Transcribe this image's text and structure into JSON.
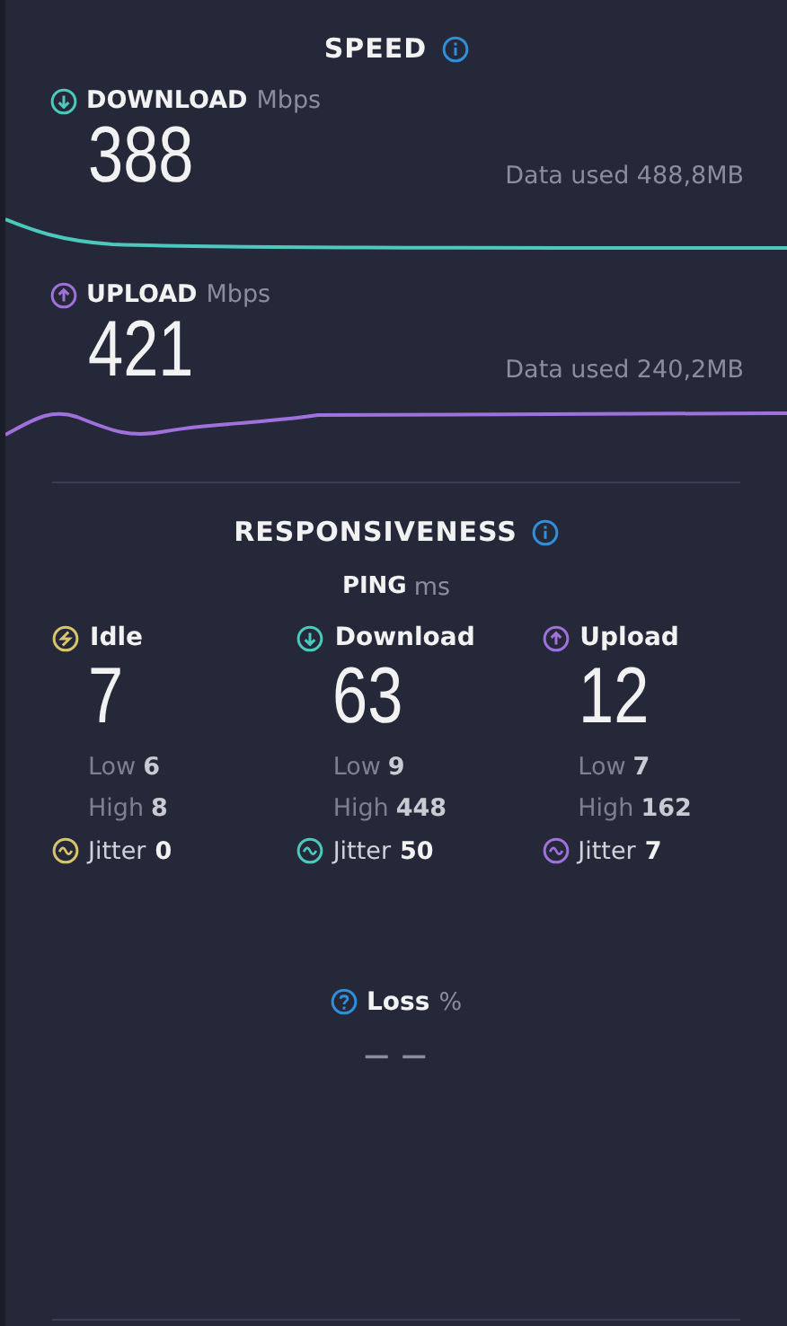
{
  "speed": {
    "title": "SPEED",
    "tests": [
      {
        "kind": "download",
        "label": "DOWNLOAD",
        "unit": "Mbps",
        "value": "388",
        "data_used": "Data used 488,8MB"
      },
      {
        "kind": "upload",
        "label": "UPLOAD",
        "unit": "Mbps",
        "value": "421",
        "data_used": "Data used 240,2MB"
      }
    ]
  },
  "responsiveness": {
    "title": "RESPONSIVENESS",
    "ping_label": "PING",
    "ping_unit": "ms",
    "metrics": [
      {
        "kind": "idle",
        "label": "Idle",
        "value": "7",
        "low_label": "Low",
        "low": "6",
        "high_label": "High",
        "high": "8",
        "jitter_label": "Jitter",
        "jitter": "0"
      },
      {
        "kind": "download",
        "label": "Download",
        "value": "63",
        "low_label": "Low",
        "low": "9",
        "high_label": "High",
        "high": "448",
        "jitter_label": "Jitter",
        "jitter": "50"
      },
      {
        "kind": "upload",
        "label": "Upload",
        "value": "12",
        "low_label": "Low",
        "low": "7",
        "high_label": "High",
        "high": "162",
        "jitter_label": "Jitter",
        "jitter": "7"
      }
    ]
  },
  "loss": {
    "label": "Loss",
    "unit": "%",
    "value": "— —"
  }
}
